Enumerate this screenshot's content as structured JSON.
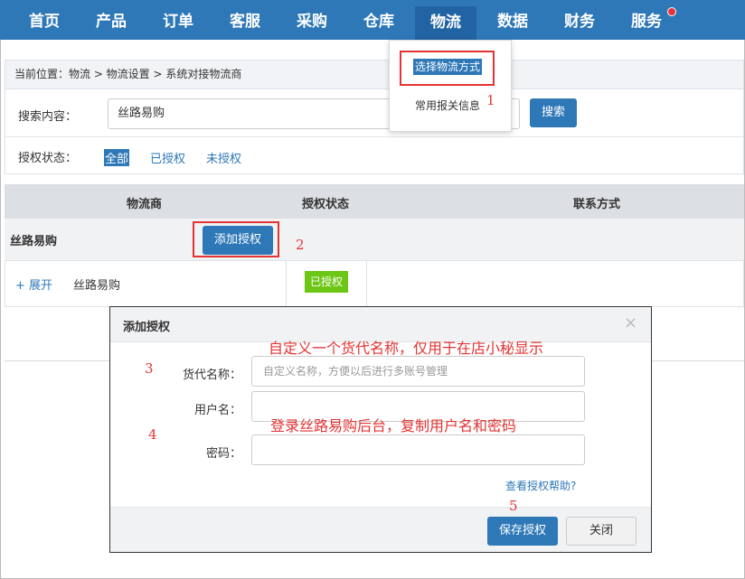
{
  "nav": {
    "items": [
      "首页",
      "产品",
      "订单",
      "客服",
      "采购",
      "仓库",
      "物流",
      "数据",
      "财务",
      "服务"
    ],
    "active": "物流"
  },
  "breadcrumb": "当前位置：物流 > 物流设置 > 系统对接物流商",
  "dropdown": {
    "items": [
      "选择物流方式",
      "常用报关信息"
    ]
  },
  "search": {
    "label": "搜索内容：",
    "value": "丝路易购",
    "button": "搜索"
  },
  "status_filter": {
    "label": "授权状态：",
    "options": [
      "全部",
      "已授权",
      "未授权"
    ],
    "selected": "全部"
  },
  "table": {
    "headers": [
      "物流商",
      "授权状态",
      "联系方式"
    ],
    "group_name": "丝路易购",
    "add_auth_button": "添加授权",
    "row": {
      "expand": "+ 展开",
      "name": "丝路易购",
      "status": "已授权"
    }
  },
  "modal": {
    "title": "添加授权",
    "close_icon": "×",
    "fields": [
      {
        "label": "货代名称：",
        "placeholder": "自定义名称，方便以后进行多账号管理"
      },
      {
        "label": "用户名：",
        "placeholder": ""
      },
      {
        "label": "密码：",
        "placeholder": ""
      }
    ],
    "help_link": "查看授权帮助?",
    "save_button": "保存授权",
    "close_button": "关闭"
  },
  "annotations": {
    "n1": "1",
    "n2": "2",
    "n3": "3",
    "n4": "4",
    "n5": "5",
    "note_name": "自定义一个货代名称，仅用于在店小秘显示",
    "note_login": "登录丝路易购后台，复制用户名和密码"
  },
  "colors": {
    "primary": "#2e78b8",
    "annotation_red": "#e53333",
    "authorized_green": "#6cc614"
  }
}
